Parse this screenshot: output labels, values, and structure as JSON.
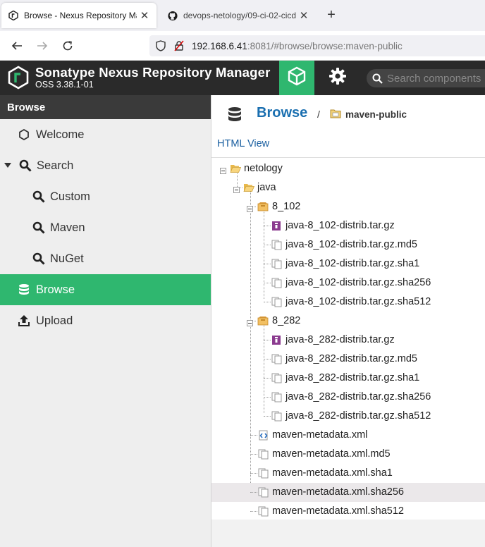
{
  "browser": {
    "tabs": [
      {
        "title": "Browse - Nexus Repository Manager",
        "favicon": "nexus-icon",
        "active": true
      },
      {
        "title": "devops-netology/09-ci-02-cicd",
        "favicon": "github-icon",
        "active": false
      }
    ],
    "url_host": "192.168.6.41",
    "url_rest": ":8081/#browse/browse:maven-public"
  },
  "header": {
    "title": "Sonatype Nexus Repository Manager",
    "version": "OSS 3.38.1-01",
    "search_placeholder": "Search components"
  },
  "sidebar": {
    "header": "Browse",
    "items": [
      {
        "label": "Welcome",
        "icon": "hexagon-icon"
      },
      {
        "label": "Search",
        "icon": "magnifier-icon"
      },
      {
        "label": "Custom",
        "icon": "magnifier-icon"
      },
      {
        "label": "Maven",
        "icon": "magnifier-icon"
      },
      {
        "label": "NuGet",
        "icon": "magnifier-icon"
      },
      {
        "label": "Browse",
        "icon": "database-icon",
        "active": true
      },
      {
        "label": "Upload",
        "icon": "upload-icon"
      }
    ]
  },
  "main": {
    "breadcrumb_root": "Browse",
    "breadcrumb_sep": "/",
    "breadcrumb_repo": "maven-public",
    "html_view": "HTML View",
    "tree": [
      {
        "label": "netology",
        "type": "folder"
      },
      {
        "label": "java",
        "type": "folder"
      },
      {
        "label": "8_102",
        "type": "component"
      },
      {
        "label": "java-8_102-distrib.tar.gz",
        "type": "archive"
      },
      {
        "label": "java-8_102-distrib.tar.gz.md5",
        "type": "file"
      },
      {
        "label": "java-8_102-distrib.tar.gz.sha1",
        "type": "file"
      },
      {
        "label": "java-8_102-distrib.tar.gz.sha256",
        "type": "file"
      },
      {
        "label": "java-8_102-distrib.tar.gz.sha512",
        "type": "file"
      },
      {
        "label": "8_282",
        "type": "component"
      },
      {
        "label": "java-8_282-distrib.tar.gz",
        "type": "archive"
      },
      {
        "label": "java-8_282-distrib.tar.gz.md5",
        "type": "file"
      },
      {
        "label": "java-8_282-distrib.tar.gz.sha1",
        "type": "file"
      },
      {
        "label": "java-8_282-distrib.tar.gz.sha256",
        "type": "file"
      },
      {
        "label": "java-8_282-distrib.tar.gz.sha512",
        "type": "file"
      },
      {
        "label": "maven-metadata.xml",
        "type": "xml"
      },
      {
        "label": "maven-metadata.xml.md5",
        "type": "file"
      },
      {
        "label": "maven-metadata.xml.sha1",
        "type": "file"
      },
      {
        "label": "maven-metadata.xml.sha256",
        "type": "file",
        "highlighted": true
      },
      {
        "label": "maven-metadata.xml.sha512",
        "type": "file"
      }
    ]
  },
  "colors": {
    "accent": "#2fb76f",
    "header_bg": "#2a2a2a",
    "link": "#1a6fb0"
  }
}
